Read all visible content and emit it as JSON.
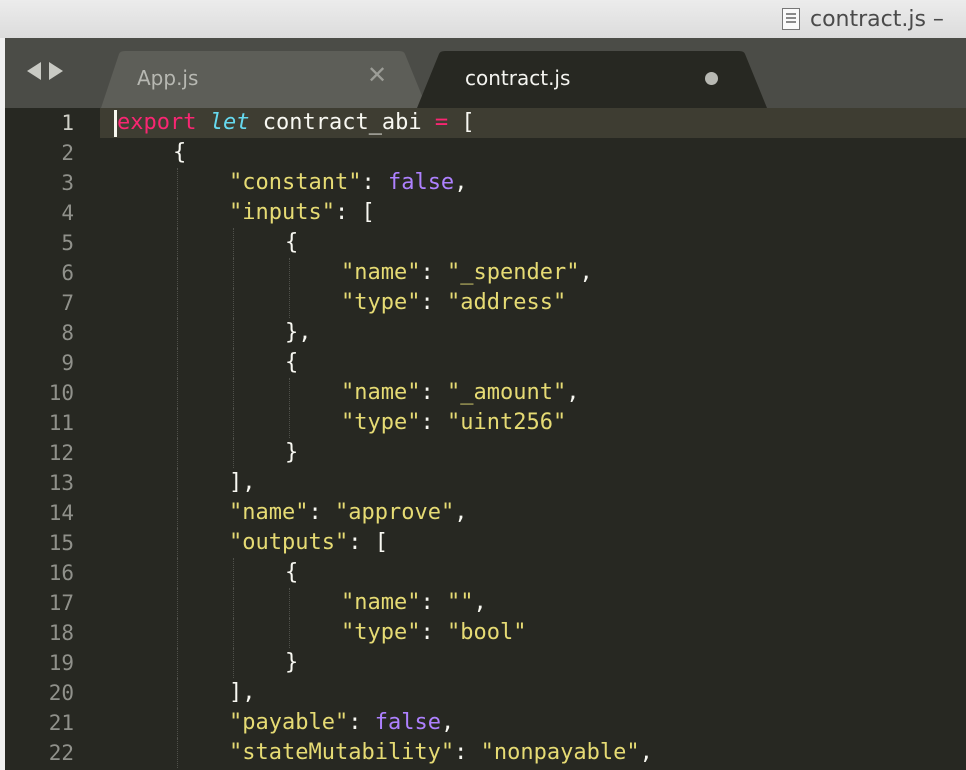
{
  "window": {
    "title": "contract.js –"
  },
  "icons": {
    "document": "document-icon",
    "back": "chevron-left-icon",
    "forward": "chevron-right-icon",
    "close": "close-icon",
    "dirty": "unsaved-dot-icon"
  },
  "tabs": [
    {
      "label": "App.js",
      "active": false,
      "close_glyph": "✕"
    },
    {
      "label": "contract.js",
      "active": true,
      "modified": true
    }
  ],
  "colors": {
    "background": "#272822",
    "keyword": "#f92672",
    "storage": "#66d9ef",
    "string": "#e6db74",
    "constant": "#ae81ff",
    "text": "#f8f8f2",
    "line_number": "#90918b",
    "active_line": "#3e3d32"
  },
  "editor": {
    "active_line_number": 1,
    "lines": [
      {
        "n": "1",
        "indent": 0,
        "tokens": [
          {
            "t": "export",
            "c": "keyword"
          },
          {
            "t": " "
          },
          {
            "t": "let",
            "c": "storage",
            "i": true
          },
          {
            "t": " contract_abi "
          },
          {
            "t": "=",
            "c": "keyword"
          },
          {
            "t": " ["
          }
        ]
      },
      {
        "n": "2",
        "indent": 1,
        "tokens": [
          {
            "t": "{"
          }
        ]
      },
      {
        "n": "3",
        "indent": 2,
        "tokens": [
          {
            "t": "\"constant\"",
            "c": "string"
          },
          {
            "t": ": "
          },
          {
            "t": "false",
            "c": "constant"
          },
          {
            "t": ","
          }
        ]
      },
      {
        "n": "4",
        "indent": 2,
        "tokens": [
          {
            "t": "\"inputs\"",
            "c": "string"
          },
          {
            "t": ": ["
          }
        ]
      },
      {
        "n": "5",
        "indent": 3,
        "tokens": [
          {
            "t": "{"
          }
        ]
      },
      {
        "n": "6",
        "indent": 4,
        "tokens": [
          {
            "t": "\"name\"",
            "c": "string"
          },
          {
            "t": ": "
          },
          {
            "t": "\"_spender\"",
            "c": "string"
          },
          {
            "t": ","
          }
        ]
      },
      {
        "n": "7",
        "indent": 4,
        "tokens": [
          {
            "t": "\"type\"",
            "c": "string"
          },
          {
            "t": ": "
          },
          {
            "t": "\"address\"",
            "c": "string"
          }
        ]
      },
      {
        "n": "8",
        "indent": 3,
        "tokens": [
          {
            "t": "},"
          }
        ]
      },
      {
        "n": "9",
        "indent": 3,
        "tokens": [
          {
            "t": "{"
          }
        ]
      },
      {
        "n": "10",
        "indent": 4,
        "tokens": [
          {
            "t": "\"name\"",
            "c": "string"
          },
          {
            "t": ": "
          },
          {
            "t": "\"_amount\"",
            "c": "string"
          },
          {
            "t": ","
          }
        ]
      },
      {
        "n": "11",
        "indent": 4,
        "tokens": [
          {
            "t": "\"type\"",
            "c": "string"
          },
          {
            "t": ": "
          },
          {
            "t": "\"uint256\"",
            "c": "string"
          }
        ]
      },
      {
        "n": "12",
        "indent": 3,
        "tokens": [
          {
            "t": "}"
          }
        ]
      },
      {
        "n": "13",
        "indent": 2,
        "tokens": [
          {
            "t": "],"
          }
        ]
      },
      {
        "n": "14",
        "indent": 2,
        "tokens": [
          {
            "t": "\"name\"",
            "c": "string"
          },
          {
            "t": ": "
          },
          {
            "t": "\"approve\"",
            "c": "string"
          },
          {
            "t": ","
          }
        ]
      },
      {
        "n": "15",
        "indent": 2,
        "tokens": [
          {
            "t": "\"outputs\"",
            "c": "string"
          },
          {
            "t": ": ["
          }
        ]
      },
      {
        "n": "16",
        "indent": 3,
        "tokens": [
          {
            "t": "{"
          }
        ]
      },
      {
        "n": "17",
        "indent": 4,
        "tokens": [
          {
            "t": "\"name\"",
            "c": "string"
          },
          {
            "t": ": "
          },
          {
            "t": "\"\"",
            "c": "string"
          },
          {
            "t": ","
          }
        ]
      },
      {
        "n": "18",
        "indent": 4,
        "tokens": [
          {
            "t": "\"type\"",
            "c": "string"
          },
          {
            "t": ": "
          },
          {
            "t": "\"bool\"",
            "c": "string"
          }
        ]
      },
      {
        "n": "19",
        "indent": 3,
        "tokens": [
          {
            "t": "}"
          }
        ]
      },
      {
        "n": "20",
        "indent": 2,
        "tokens": [
          {
            "t": "],"
          }
        ]
      },
      {
        "n": "21",
        "indent": 2,
        "tokens": [
          {
            "t": "\"payable\"",
            "c": "string"
          },
          {
            "t": ": "
          },
          {
            "t": "false",
            "c": "constant"
          },
          {
            "t": ","
          }
        ]
      },
      {
        "n": "22",
        "indent": 2,
        "tokens": [
          {
            "t": "\"stateMutability\"",
            "c": "string"
          },
          {
            "t": ": "
          },
          {
            "t": "\"nonpayable\"",
            "c": "string"
          },
          {
            "t": ","
          }
        ]
      }
    ]
  }
}
